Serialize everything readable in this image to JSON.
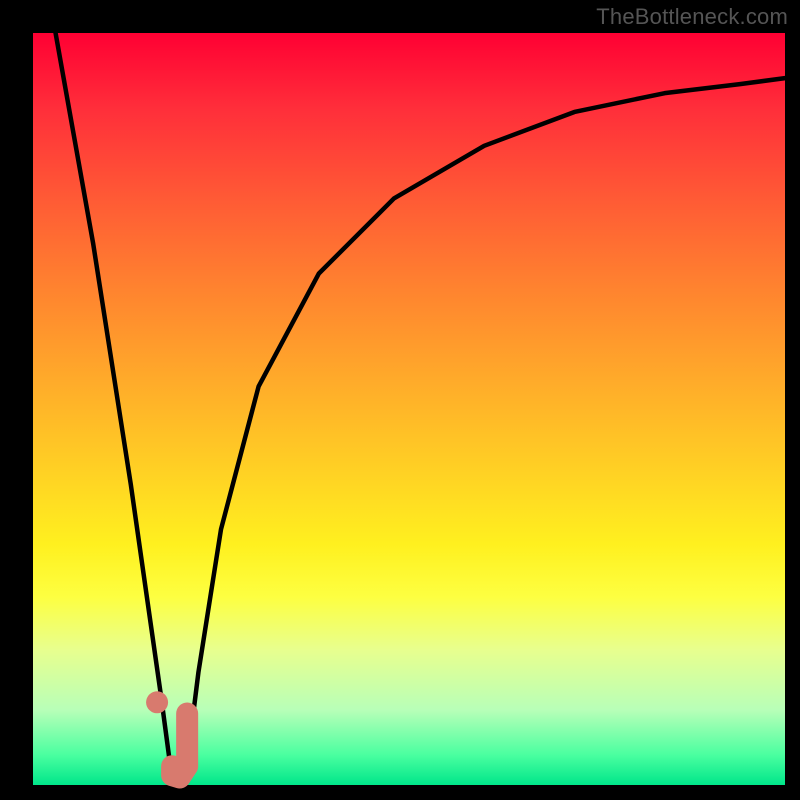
{
  "watermark": "TheBottleneck.com",
  "chart_data": {
    "type": "line",
    "title": "",
    "xlabel": "",
    "ylabel": "",
    "xlim": [
      0,
      100
    ],
    "ylim": [
      0,
      100
    ],
    "grid": false,
    "series": [
      {
        "name": "left-limb",
        "stroke": "#000000",
        "x": [
          3,
          8,
          13,
          17,
          18.2
        ],
        "values": [
          100,
          72,
          40,
          12,
          3
        ]
      },
      {
        "name": "right-limb",
        "stroke": "#000000",
        "x": [
          20.5,
          22,
          25,
          30,
          38,
          48,
          60,
          72,
          84,
          94,
          100
        ],
        "values": [
          3,
          15,
          34,
          53,
          68,
          78,
          85,
          89.5,
          92,
          93.2,
          94
        ]
      },
      {
        "name": "marker-dot",
        "type": "scatter",
        "color": "#d87a6e",
        "x": [
          16.5
        ],
        "values": [
          11
        ]
      },
      {
        "name": "marker-j",
        "stroke": "#d87a6e",
        "x": [
          18.5,
          18.5,
          19.5,
          20.5,
          20.5
        ],
        "values": [
          2.5,
          1.3,
          1.0,
          2.5,
          9.5
        ]
      }
    ],
    "gradient_stops": [
      {
        "pos": 0,
        "color": "#ff0033"
      },
      {
        "pos": 25,
        "color": "#ff7a30"
      },
      {
        "pos": 50,
        "color": "#ffc326"
      },
      {
        "pos": 70,
        "color": "#fff430"
      },
      {
        "pos": 88,
        "color": "#c9ffb0"
      },
      {
        "pos": 100,
        "color": "#00e68a"
      }
    ]
  }
}
